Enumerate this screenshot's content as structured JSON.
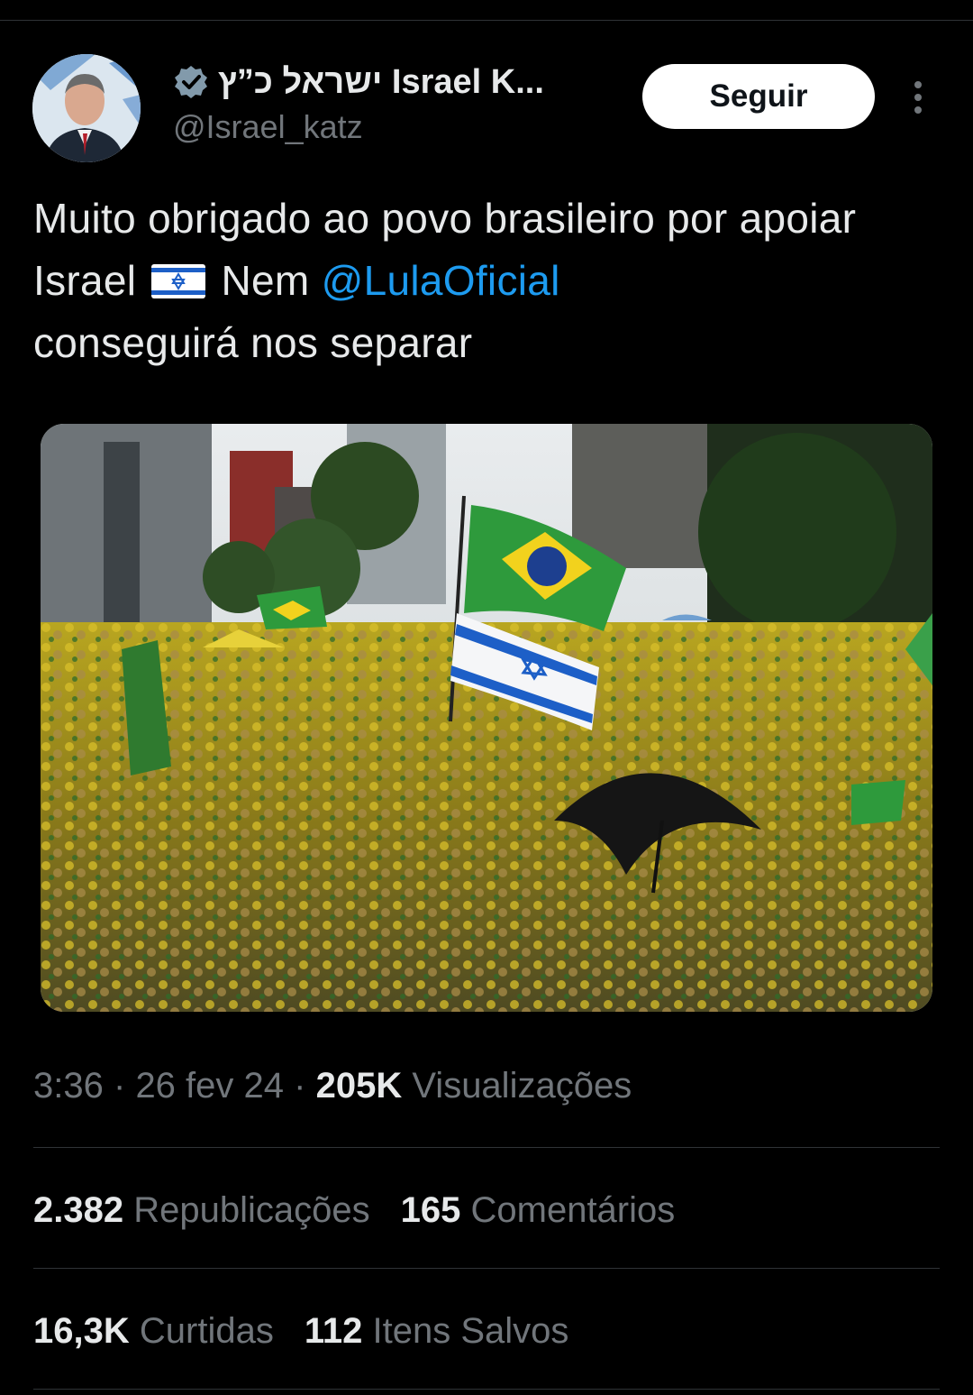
{
  "tweet": {
    "author": {
      "display_name": "ישראל כ”ץ Israel K...",
      "handle": "@Israel_katz",
      "verified": true,
      "avatar_icon": "profile-photo"
    },
    "follow_label": "Seguir",
    "text_part1": "Muito obrigado ao povo brasileiro por apoiar Israel",
    "text_flag": "🇮🇱",
    "text_part2": "Nem",
    "mention": "@LulaOficial",
    "text_part3": "conseguirá nos separar",
    "media_alt": "Multidão com camisetas amarelas e bandeiras do Brasil e de Israel",
    "time": "3:36",
    "date": "26 fev 24",
    "views_count": "205K",
    "views_label": "Visualizações",
    "separator": "·",
    "stats": {
      "reposts_count": "2.382",
      "reposts_label": "Republicações",
      "comments_count": "165",
      "comments_label": "Comentários",
      "likes_count": "16,3K",
      "likes_label": "Curtidas",
      "saves_count": "112",
      "saves_label": "Itens Salvos"
    }
  },
  "colors": {
    "background": "#000000",
    "text": "#e7e9ea",
    "muted": "#71767b",
    "link": "#1d9bf0",
    "divider": "#2f3336"
  }
}
